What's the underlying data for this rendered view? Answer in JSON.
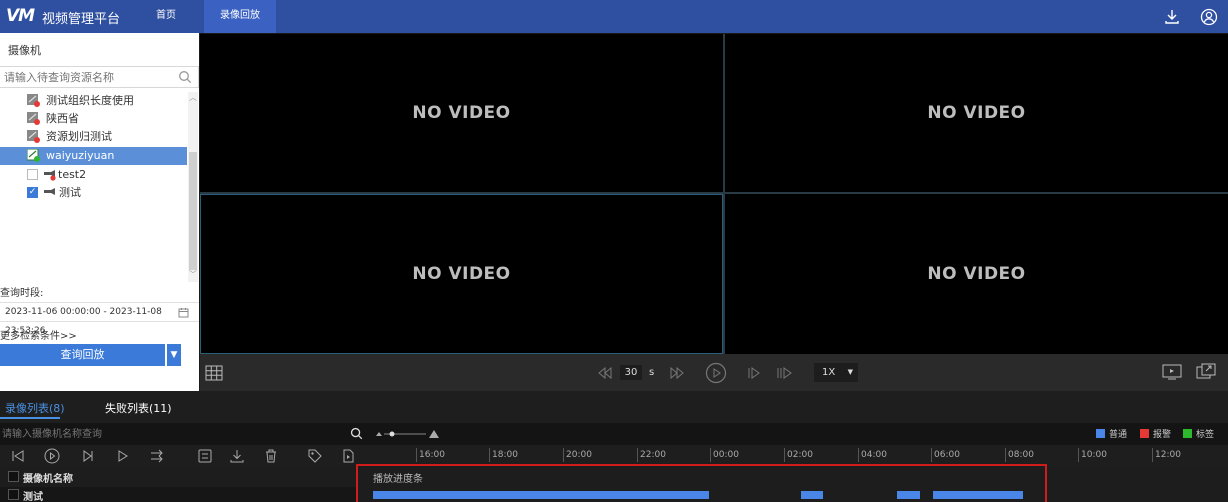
{
  "header": {
    "logo": "VM",
    "brand": "视频管理平台",
    "tabs": [
      {
        "label": "首页",
        "active": false
      },
      {
        "label": "录像回放",
        "active": true
      }
    ],
    "icons": [
      "download-icon",
      "user-icon"
    ]
  },
  "sidebar": {
    "title": "摄像机",
    "search_placeholder": "请输入待查询资源名称",
    "tree": [
      {
        "label": "测试组织长度使用",
        "icon": "folder-offline-icon"
      },
      {
        "label": "陕西省",
        "icon": "folder-offline-icon"
      },
      {
        "label": "资源划归测试",
        "icon": "folder-offline-icon"
      },
      {
        "label": "waiyuziyuan",
        "icon": "folder-online-icon",
        "selected": true
      },
      {
        "label": "test2",
        "icon": "camera-offline-icon",
        "checked": false
      },
      {
        "label": "测试",
        "icon": "camera-icon",
        "checked": true
      }
    ],
    "period_label": "查询时段:",
    "date_range": "2023-11-06 00:00:00 - 2023-11-08 23:53:26",
    "more_conditions": "更多检索条件>>",
    "query_button": "查询回放"
  },
  "video": {
    "cells": [
      "NO VIDEO",
      "NO VIDEO",
      "NO VIDEO",
      "NO VIDEO"
    ]
  },
  "controls": {
    "step_value": "30",
    "step_unit": "s",
    "speed": "1X"
  },
  "lower": {
    "tabs": [
      {
        "label": "录像列表(8)",
        "active": true
      },
      {
        "label": "失败列表(11)",
        "active": false
      }
    ],
    "camera_search_placeholder": "请输入摄像机名称查询",
    "legend": [
      {
        "label": "普通",
        "color": "#4a86e8"
      },
      {
        "label": "报警",
        "color": "#e53935"
      },
      {
        "label": "标签",
        "color": "#2eb82e"
      }
    ],
    "ticks": [
      "16:00",
      "18:00",
      "20:00",
      "22:00",
      "00:00",
      "02:00",
      "04:00",
      "06:00",
      "08:00",
      "10:00",
      "12:00"
    ],
    "column_header": "摄像机名称",
    "progress_label": "播放进度条",
    "rows": [
      {
        "name": "测试"
      }
    ]
  },
  "colors": {
    "accent": "#2f4fa0",
    "selected": "#5b8fd8",
    "record": "#4a86e8",
    "highlight_box": "#d11c1c"
  }
}
